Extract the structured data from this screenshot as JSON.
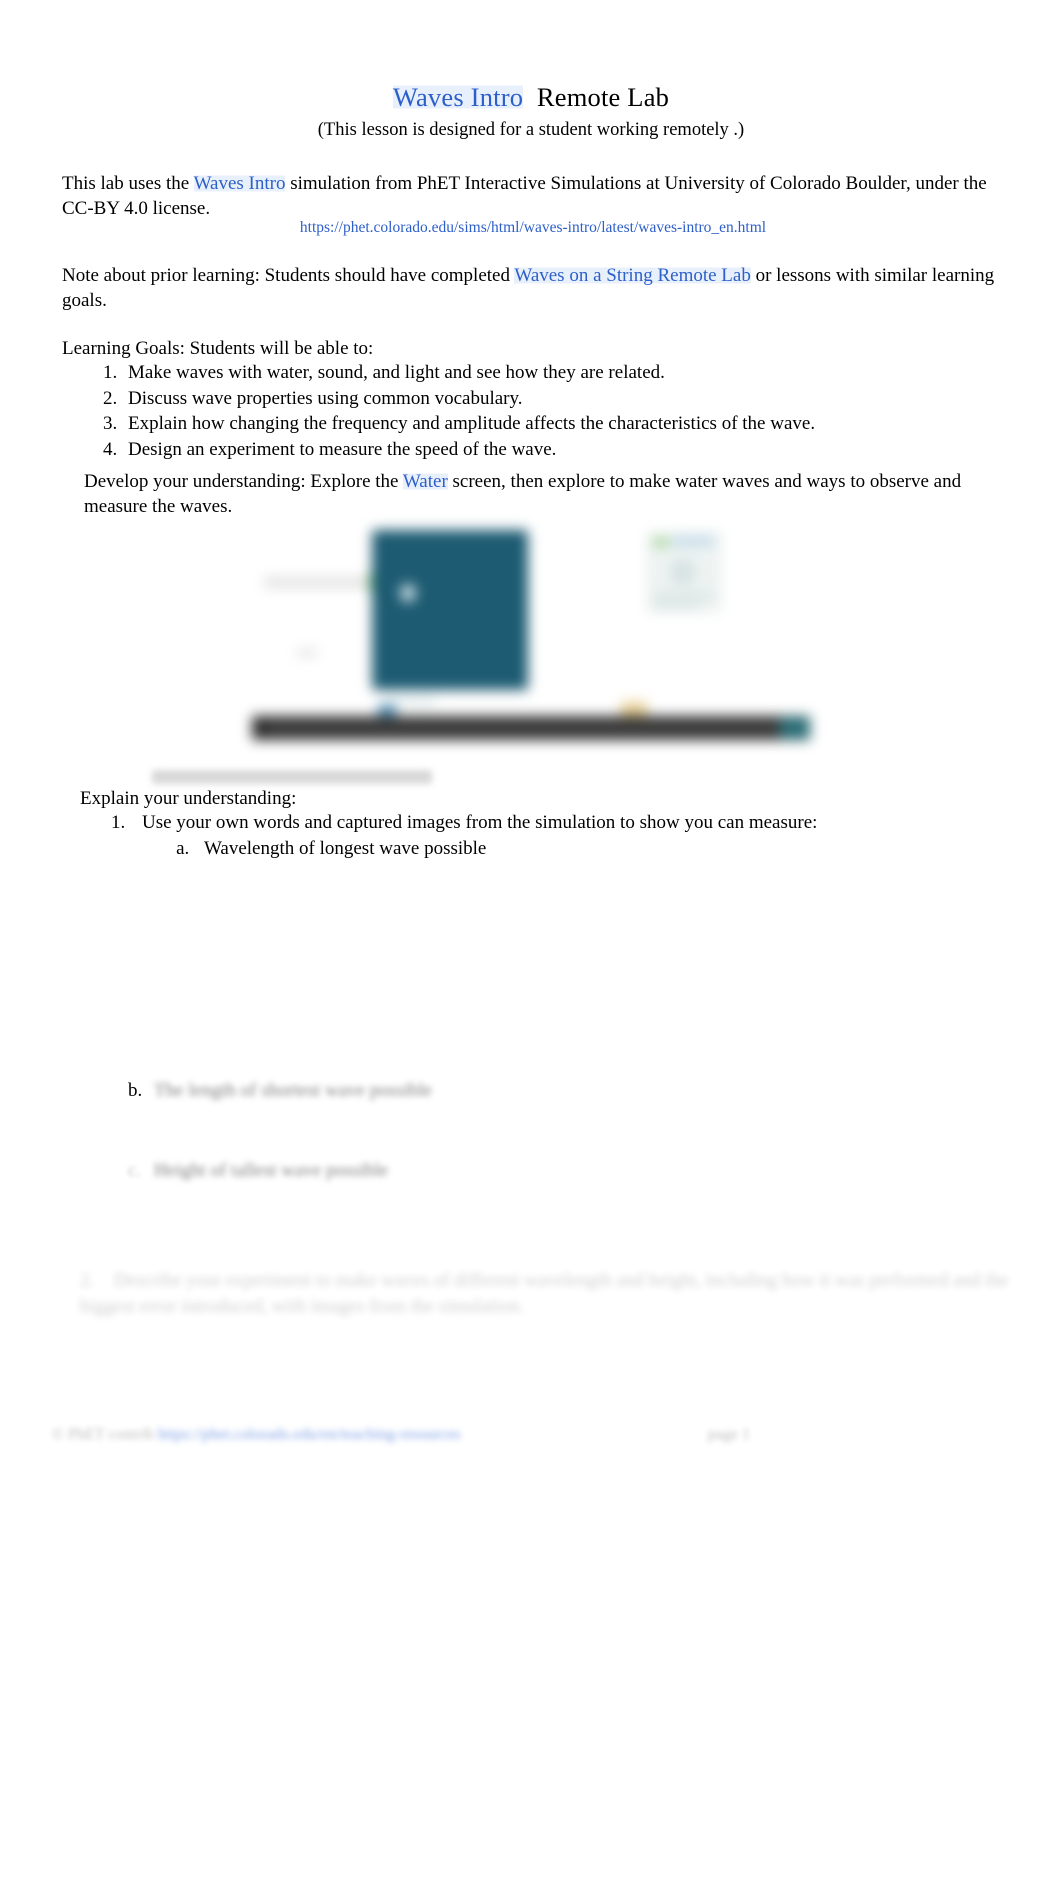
{
  "document": {
    "title_link": "Waves Intro",
    "title_rest": "Remote Lab",
    "subtitle": "(This lesson is designed for a student working remotely .)",
    "intro": {
      "before_link": "This lab uses the ",
      "link": "Waves Intro",
      "after_link": " simulation from PhET Interactive Simulations at University of Colorado Boulder, under the CC-BY 4.0 license."
    },
    "sim_url": "https://phet.colorado.edu/sims/html/waves-intro/latest/waves-intro_en.html",
    "prior_learning": {
      "label": "Note about prior learning:",
      "before_link": "  Students should have completed ",
      "link": "Waves on a String Remote Lab",
      "after_link": " or lessons with similar learning goals."
    },
    "learning_goals": {
      "heading": "Learning Goals:  Students will be able to:",
      "items": [
        "Make waves with water, sound, and light and see how they are related.",
        "Discuss wave properties using common vocabulary.",
        "Explain how changing the frequency and amplitude affects the characteristics of the wave.",
        "Design an experiment to measure the speed of the wave."
      ]
    },
    "develop": {
      "label": "Develop your understanding:",
      "before_link": "   Explore the ",
      "link": "Water",
      "after_link": " screen, then explore to make water waves and ways to observe and measure the waves."
    },
    "simulation_figure": {
      "alt": "blurred screenshot of the PhET Waves Intro water screen"
    },
    "explain": {
      "heading": "Explain your understanding:",
      "item_1": "Use your own words and captured images from the simulation to show you can measure:",
      "sub_a": "Wavelength of longest wave possible",
      "sub_b_marker": "b.",
      "sub_b": "The length of shortest wave possible",
      "sub_c_marker": "c.",
      "sub_c": "Height of tallest wave possible",
      "item_2_number": "2.",
      "item_2": "Describe your experiment to make waves of different wavelength and height, including how it was performed and the biggest error introduced, with images from the simulation."
    },
    "footer": {
      "credit": "© PhET contrib",
      "link": "https://phet.colorado.edu/en/teaching-resources",
      "page": "page 1"
    },
    "colors": {
      "link_blue": "#2d5fc9",
      "text_black": "#000000",
      "sim_water": "#1d5b72",
      "sim_dark_bar": "#2e2e2e",
      "page_background": "#ffffff"
    }
  }
}
